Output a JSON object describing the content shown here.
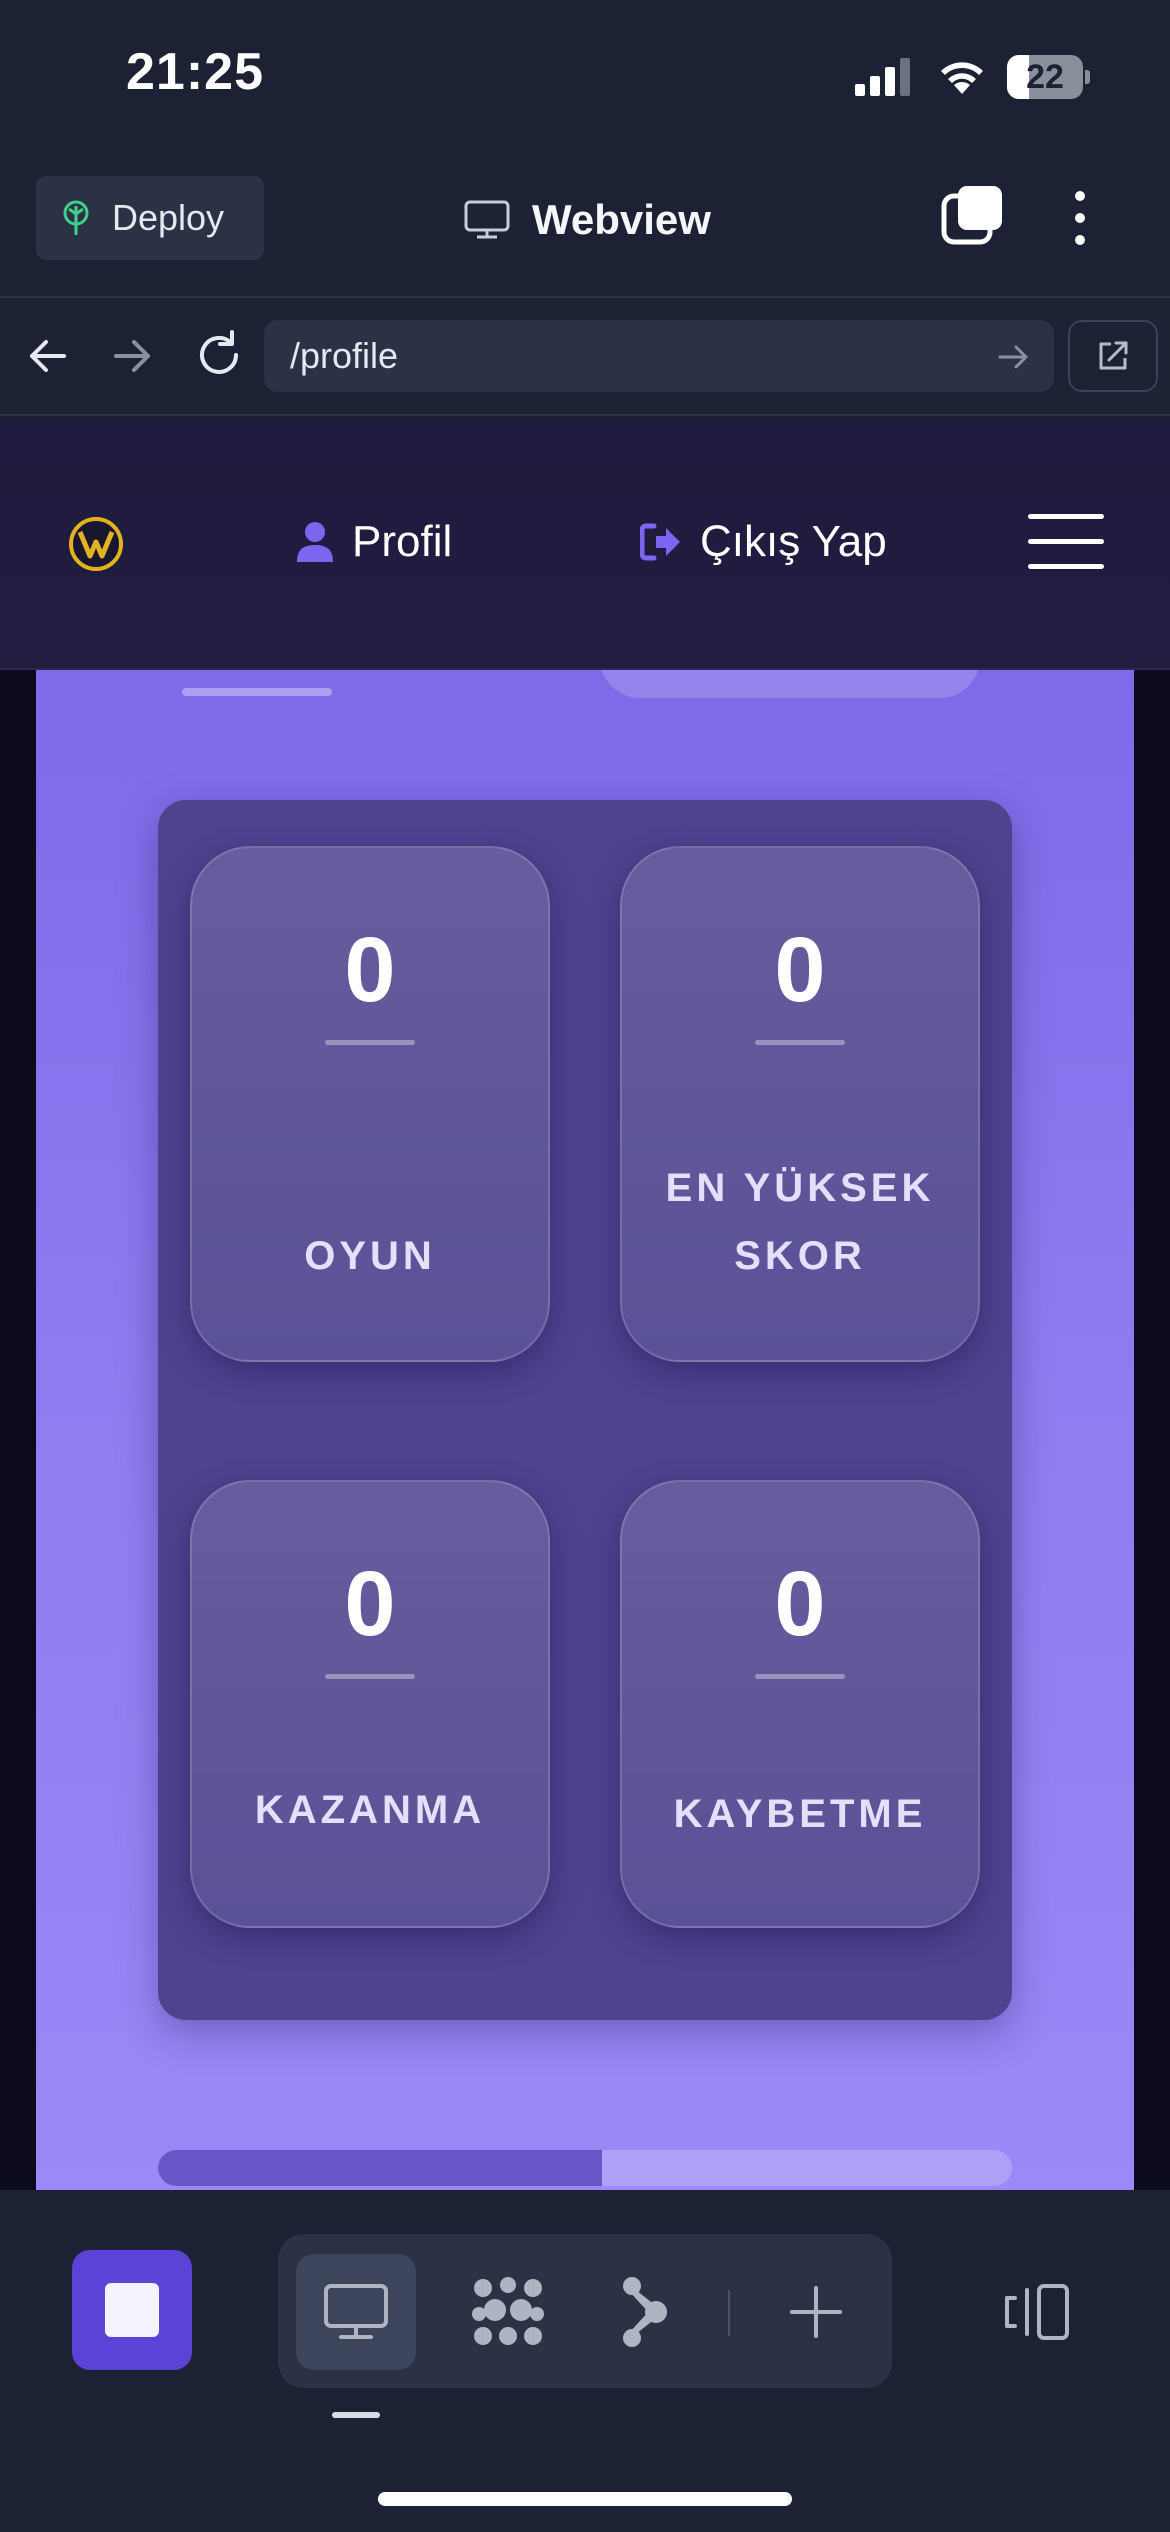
{
  "status_bar": {
    "time": "21:25",
    "battery": "22"
  },
  "header": {
    "deploy_label": "Deploy",
    "title": "Webview"
  },
  "url_bar": {
    "path": "/profile"
  },
  "app_nav": {
    "profile_label": "Profil",
    "logout_label": "Çıkış Yap"
  },
  "stats": [
    {
      "value": "0",
      "label": "OYUN"
    },
    {
      "value": "0",
      "label": "EN YÜKSEK\nSKOR"
    },
    {
      "value": "0",
      "label": "KAZANMA"
    },
    {
      "value": "0",
      "label": "KAYBETME"
    }
  ],
  "scroll": {
    "position": 0.52
  },
  "colors": {
    "accent": "#5b43d8",
    "panel_purple": "#8f7df2",
    "stats_bg": "#4d438e",
    "logo_gold": "#e0b420"
  },
  "icons": {
    "deploy": "deploy-tree-icon",
    "webview": "monitor-icon",
    "profile": "user-icon",
    "logout": "sign-out-icon",
    "menu": "hamburger-icon"
  }
}
